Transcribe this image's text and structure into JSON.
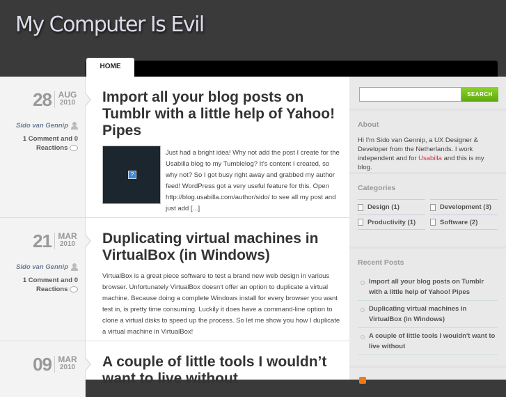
{
  "site": {
    "title": "My Computer Is Evil"
  },
  "nav": {
    "home": "HOME"
  },
  "posts": [
    {
      "day": "28",
      "month": "AUG",
      "year": "2010",
      "author": "Sido van Gennip",
      "comments": "1 Comment and 0 Reactions",
      "title": "Import all your blog posts on Tumblr with a little help of Yahoo! Pipes",
      "excerpt": "Just had a bright idea! Why not add the post I create for the Usabilla blog to my Tumblelog? It's content I created, so why not? So I got busy right away and grabbed my author feed! WordPress got a very useful feature for this. Open http://blog.usabilla.com/author/sido/ to see all my post and just add [...]",
      "thumb_icon": "?"
    },
    {
      "day": "21",
      "month": "MAR",
      "year": "2010",
      "author": "Sido van Gennip",
      "comments": "1 Comment and 0 Reactions",
      "title": "Duplicating virtual machines in VirtualBox (in Windows)",
      "excerpt": "VirtualBox is a great piece software to test a brand new web design in various browser. Unfortunately VirtualBox doesn't offer an option to duplicate a virtual machine. Because doing a complete Windows install for every browser you want test in, is pretty time consuming. Luckily it does have a command-line option to clone a virtual disks to speed up the process. So let me show you how I duplicate a virtual machine in VirtualBox!"
    },
    {
      "day": "09",
      "month": "MAR",
      "year": "2010",
      "title": "A couple of little tools I wouldn’t want to live without"
    }
  ],
  "sidebar": {
    "search_button": "SEARCH",
    "search_value": "",
    "about_title": "About",
    "about_pre": "Hi I'm Sido van Gennip, a UX Designer & Developer from the Netherlands. I work independent and for ",
    "about_link": "Usabilla",
    "about_post": " and this is my blog.",
    "categories_title": "Categories",
    "categories": [
      "Design (1)",
      "Development (3)",
      "Productivity (1)",
      "Software (2)"
    ],
    "recent_title": "Recent Posts",
    "recent": [
      "Import all your blog posts on Tumblr with a little help of Yahoo! Pipes",
      "Duplicating virtual machines in VirtualBox (in Windows)",
      "A couple of little tools I wouldn't want to live without"
    ]
  }
}
